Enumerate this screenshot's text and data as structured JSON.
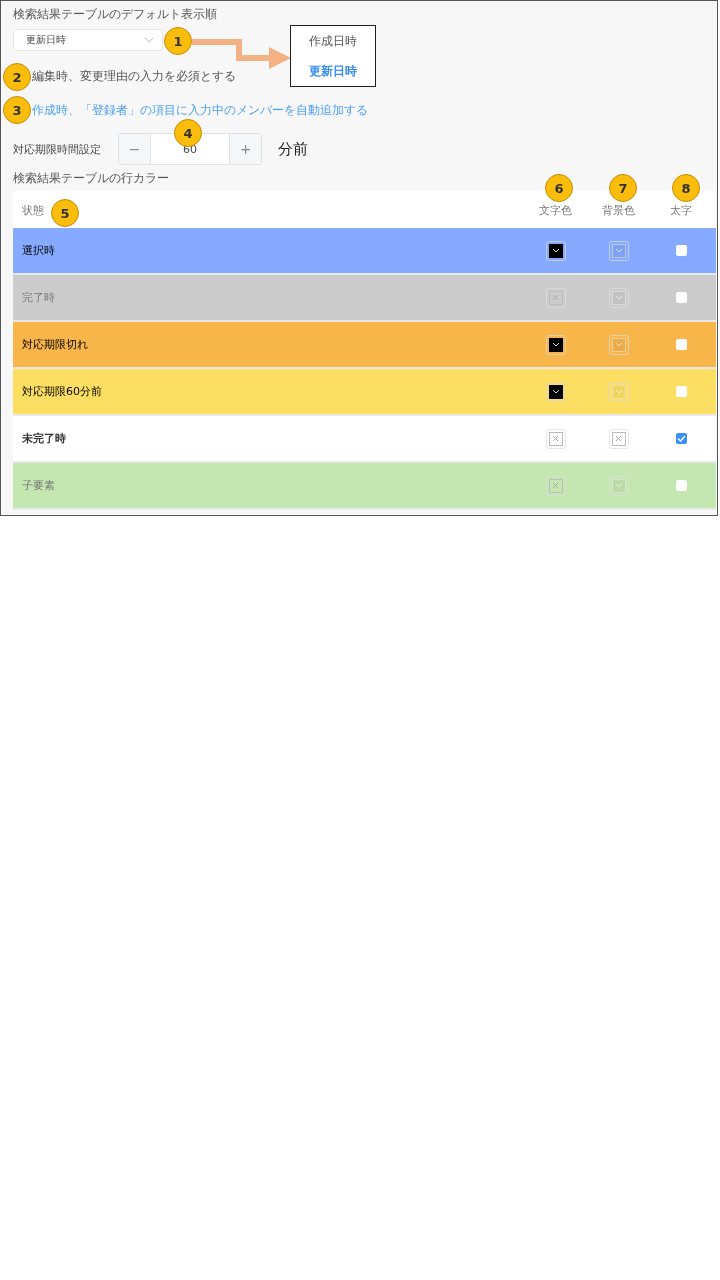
{
  "sort_setting": {
    "label": "検索結果テーブルのデフォルト表示順",
    "value": "更新日時"
  },
  "sort_menu": [
    {
      "label": "作成日時",
      "selected": false
    },
    {
      "label": "更新日時",
      "selected": true
    }
  ],
  "options": [
    {
      "label": "編集時、変更理由の入力を必須とする",
      "kind": "plain"
    },
    {
      "label": "作成時、「登録者」の項目に入力中のメンバーを自動追加する",
      "kind": "link"
    }
  ],
  "deadline": {
    "label": "対応期限時間設定",
    "minus": "−",
    "value": "60",
    "plus": "+",
    "unit": "分前"
  },
  "row_color_title": "検索結果テーブルの行カラー",
  "table": {
    "columns": [
      "状態",
      "文字色",
      "背景色",
      "太字"
    ],
    "rows": [
      {
        "label": "選択時",
        "color": "#85aaff",
        "text_swatch": {
          "kind": "color",
          "color": "#000000"
        },
        "bg_swatch": {
          "kind": "color"
        },
        "bold": false
      },
      {
        "label": "完了時",
        "color": "#cccccc",
        "text_swatch": {
          "kind": "empty"
        },
        "bg_swatch": {
          "kind": "color"
        },
        "bold": false
      },
      {
        "label": "対応期限切れ",
        "color": "#f8b54a",
        "text_swatch": {
          "kind": "color",
          "color": "#000000"
        },
        "bg_swatch": {
          "kind": "color"
        },
        "bold": false
      },
      {
        "label": "対応期限60分前",
        "color": "#fcdf62",
        "text_swatch": {
          "kind": "color",
          "color": "#000000"
        },
        "bg_swatch": {
          "kind": "color"
        },
        "bold": false
      },
      {
        "label": "未完了時",
        "color": "#ffffff",
        "text_swatch": {
          "kind": "empty"
        },
        "bg_swatch": {
          "kind": "empty"
        },
        "bold": true
      },
      {
        "label": "子要素",
        "color": "#c4e6b1",
        "text_swatch": {
          "kind": "empty"
        },
        "bg_swatch": {
          "kind": "color"
        },
        "bold": false
      }
    ]
  },
  "callouts": [
    "1",
    "2",
    "3",
    "4",
    "5",
    "6",
    "7",
    "8"
  ]
}
